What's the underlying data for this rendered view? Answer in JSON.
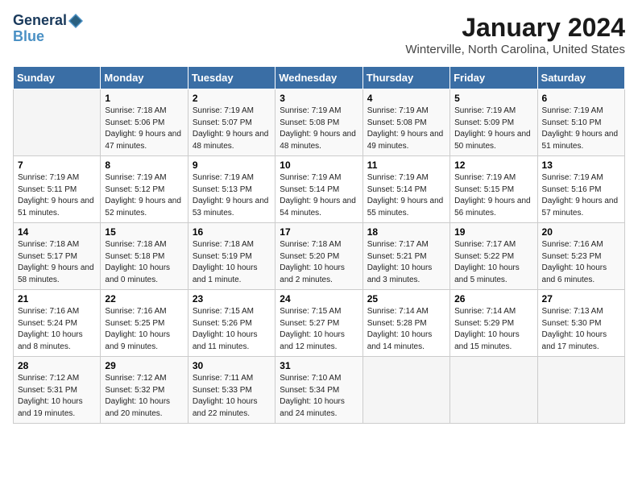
{
  "logo": {
    "line1": "General",
    "line2": "Blue"
  },
  "title": "January 2024",
  "subtitle": "Winterville, North Carolina, United States",
  "days_header": [
    "Sunday",
    "Monday",
    "Tuesday",
    "Wednesday",
    "Thursday",
    "Friday",
    "Saturday"
  ],
  "weeks": [
    [
      {
        "day": "",
        "sunrise": "",
        "sunset": "",
        "daylight": ""
      },
      {
        "day": "1",
        "sunrise": "Sunrise: 7:18 AM",
        "sunset": "Sunset: 5:06 PM",
        "daylight": "Daylight: 9 hours and 47 minutes."
      },
      {
        "day": "2",
        "sunrise": "Sunrise: 7:19 AM",
        "sunset": "Sunset: 5:07 PM",
        "daylight": "Daylight: 9 hours and 48 minutes."
      },
      {
        "day": "3",
        "sunrise": "Sunrise: 7:19 AM",
        "sunset": "Sunset: 5:08 PM",
        "daylight": "Daylight: 9 hours and 48 minutes."
      },
      {
        "day": "4",
        "sunrise": "Sunrise: 7:19 AM",
        "sunset": "Sunset: 5:08 PM",
        "daylight": "Daylight: 9 hours and 49 minutes."
      },
      {
        "day": "5",
        "sunrise": "Sunrise: 7:19 AM",
        "sunset": "Sunset: 5:09 PM",
        "daylight": "Daylight: 9 hours and 50 minutes."
      },
      {
        "day": "6",
        "sunrise": "Sunrise: 7:19 AM",
        "sunset": "Sunset: 5:10 PM",
        "daylight": "Daylight: 9 hours and 51 minutes."
      }
    ],
    [
      {
        "day": "7",
        "sunrise": "Sunrise: 7:19 AM",
        "sunset": "Sunset: 5:11 PM",
        "daylight": "Daylight: 9 hours and 51 minutes."
      },
      {
        "day": "8",
        "sunrise": "Sunrise: 7:19 AM",
        "sunset": "Sunset: 5:12 PM",
        "daylight": "Daylight: 9 hours and 52 minutes."
      },
      {
        "day": "9",
        "sunrise": "Sunrise: 7:19 AM",
        "sunset": "Sunset: 5:13 PM",
        "daylight": "Daylight: 9 hours and 53 minutes."
      },
      {
        "day": "10",
        "sunrise": "Sunrise: 7:19 AM",
        "sunset": "Sunset: 5:14 PM",
        "daylight": "Daylight: 9 hours and 54 minutes."
      },
      {
        "day": "11",
        "sunrise": "Sunrise: 7:19 AM",
        "sunset": "Sunset: 5:14 PM",
        "daylight": "Daylight: 9 hours and 55 minutes."
      },
      {
        "day": "12",
        "sunrise": "Sunrise: 7:19 AM",
        "sunset": "Sunset: 5:15 PM",
        "daylight": "Daylight: 9 hours and 56 minutes."
      },
      {
        "day": "13",
        "sunrise": "Sunrise: 7:19 AM",
        "sunset": "Sunset: 5:16 PM",
        "daylight": "Daylight: 9 hours and 57 minutes."
      }
    ],
    [
      {
        "day": "14",
        "sunrise": "Sunrise: 7:18 AM",
        "sunset": "Sunset: 5:17 PM",
        "daylight": "Daylight: 9 hours and 58 minutes."
      },
      {
        "day": "15",
        "sunrise": "Sunrise: 7:18 AM",
        "sunset": "Sunset: 5:18 PM",
        "daylight": "Daylight: 10 hours and 0 minutes."
      },
      {
        "day": "16",
        "sunrise": "Sunrise: 7:18 AM",
        "sunset": "Sunset: 5:19 PM",
        "daylight": "Daylight: 10 hours and 1 minute."
      },
      {
        "day": "17",
        "sunrise": "Sunrise: 7:18 AM",
        "sunset": "Sunset: 5:20 PM",
        "daylight": "Daylight: 10 hours and 2 minutes."
      },
      {
        "day": "18",
        "sunrise": "Sunrise: 7:17 AM",
        "sunset": "Sunset: 5:21 PM",
        "daylight": "Daylight: 10 hours and 3 minutes."
      },
      {
        "day": "19",
        "sunrise": "Sunrise: 7:17 AM",
        "sunset": "Sunset: 5:22 PM",
        "daylight": "Daylight: 10 hours and 5 minutes."
      },
      {
        "day": "20",
        "sunrise": "Sunrise: 7:16 AM",
        "sunset": "Sunset: 5:23 PM",
        "daylight": "Daylight: 10 hours and 6 minutes."
      }
    ],
    [
      {
        "day": "21",
        "sunrise": "Sunrise: 7:16 AM",
        "sunset": "Sunset: 5:24 PM",
        "daylight": "Daylight: 10 hours and 8 minutes."
      },
      {
        "day": "22",
        "sunrise": "Sunrise: 7:16 AM",
        "sunset": "Sunset: 5:25 PM",
        "daylight": "Daylight: 10 hours and 9 minutes."
      },
      {
        "day": "23",
        "sunrise": "Sunrise: 7:15 AM",
        "sunset": "Sunset: 5:26 PM",
        "daylight": "Daylight: 10 hours and 11 minutes."
      },
      {
        "day": "24",
        "sunrise": "Sunrise: 7:15 AM",
        "sunset": "Sunset: 5:27 PM",
        "daylight": "Daylight: 10 hours and 12 minutes."
      },
      {
        "day": "25",
        "sunrise": "Sunrise: 7:14 AM",
        "sunset": "Sunset: 5:28 PM",
        "daylight": "Daylight: 10 hours and 14 minutes."
      },
      {
        "day": "26",
        "sunrise": "Sunrise: 7:14 AM",
        "sunset": "Sunset: 5:29 PM",
        "daylight": "Daylight: 10 hours and 15 minutes."
      },
      {
        "day": "27",
        "sunrise": "Sunrise: 7:13 AM",
        "sunset": "Sunset: 5:30 PM",
        "daylight": "Daylight: 10 hours and 17 minutes."
      }
    ],
    [
      {
        "day": "28",
        "sunrise": "Sunrise: 7:12 AM",
        "sunset": "Sunset: 5:31 PM",
        "daylight": "Daylight: 10 hours and 19 minutes."
      },
      {
        "day": "29",
        "sunrise": "Sunrise: 7:12 AM",
        "sunset": "Sunset: 5:32 PM",
        "daylight": "Daylight: 10 hours and 20 minutes."
      },
      {
        "day": "30",
        "sunrise": "Sunrise: 7:11 AM",
        "sunset": "Sunset: 5:33 PM",
        "daylight": "Daylight: 10 hours and 22 minutes."
      },
      {
        "day": "31",
        "sunrise": "Sunrise: 7:10 AM",
        "sunset": "Sunset: 5:34 PM",
        "daylight": "Daylight: 10 hours and 24 minutes."
      },
      {
        "day": "",
        "sunrise": "",
        "sunset": "",
        "daylight": ""
      },
      {
        "day": "",
        "sunrise": "",
        "sunset": "",
        "daylight": ""
      },
      {
        "day": "",
        "sunrise": "",
        "sunset": "",
        "daylight": ""
      }
    ]
  ]
}
